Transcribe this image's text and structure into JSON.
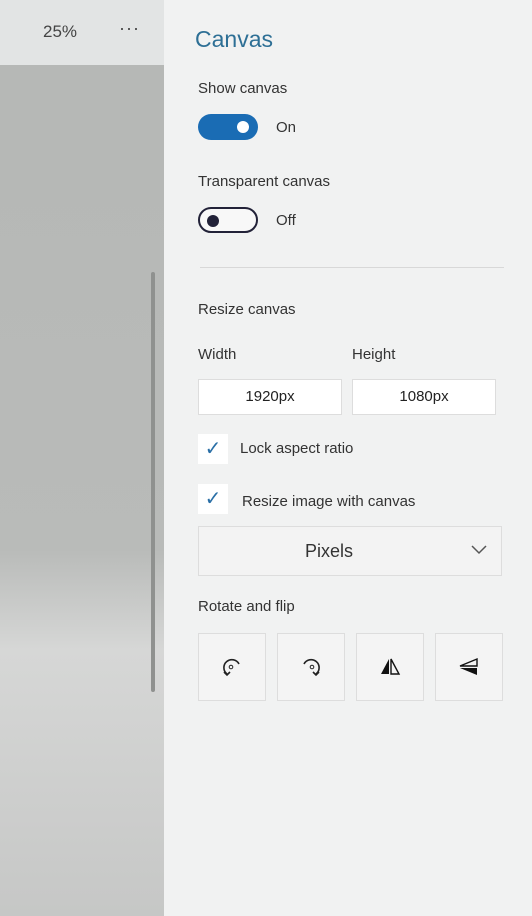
{
  "toolbar": {
    "zoom_level": "25%",
    "more_label": "···"
  },
  "panel": {
    "title": "Canvas",
    "show_canvas": {
      "label": "Show canvas",
      "state": "On",
      "on": true
    },
    "transparent_canvas": {
      "label": "Transparent canvas",
      "state": "Off",
      "on": false
    },
    "resize": {
      "label": "Resize canvas",
      "width_label": "Width",
      "height_label": "Height",
      "width_value": "1920px",
      "height_value": "1080px",
      "lock_aspect": {
        "label": "Lock aspect ratio",
        "checked": true
      },
      "resize_image": {
        "label": "Resize image with canvas",
        "checked": true
      },
      "unit": "Pixels"
    },
    "rotate": {
      "label": "Rotate and flip",
      "buttons": [
        "rotate-left",
        "rotate-right",
        "flip-horizontal",
        "flip-vertical"
      ]
    },
    "accent": "#1a6cb4"
  }
}
